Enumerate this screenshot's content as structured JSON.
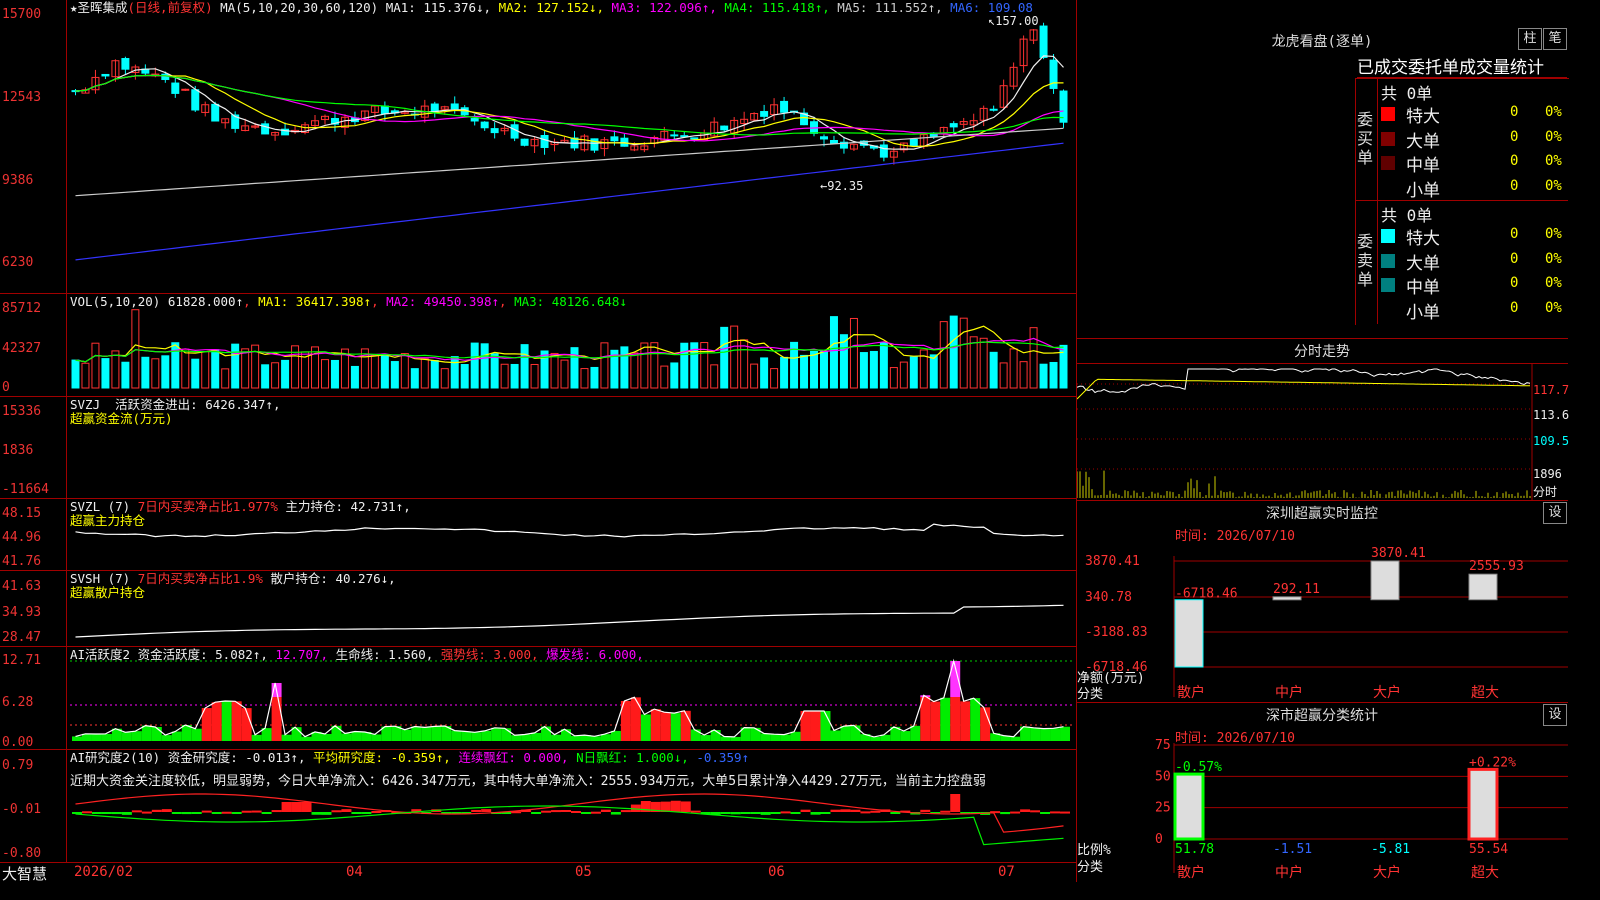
{
  "stock": {
    "name": "★圣晖集成",
    "mode": "(日线,前复权)"
  },
  "main": {
    "ma_label": "MA(5,10,20,30,60,120)",
    "ma": [
      {
        "t": "MA1: 115.376↓",
        "c": "#eeeeee"
      },
      {
        "t": "MA2: 127.152↓",
        "c": "#ffff00"
      },
      {
        "t": "MA3: 122.096↑",
        "c": "#ff00ff"
      },
      {
        "t": "MA4: 115.418↑",
        "c": "#00ff00"
      },
      {
        "t": "MA5: 111.552↑",
        "c": "#cccccc"
      },
      {
        "t": "MA6: 109.08",
        "c": "#3366ff"
      }
    ],
    "yticks": [
      "15700",
      "12543",
      "9386",
      "6230"
    ],
    "high": "157.00",
    "low": "92.35"
  },
  "vol": {
    "label": "VOL(5,10,20)",
    "v": "61828.000↑",
    "ma1": "MA1: 36417.398↑",
    "ma2": "MA2: 49450.398↑",
    "ma3": "MA3: 48126.648↓",
    "yticks": [
      "85712",
      "42327",
      "0"
    ]
  },
  "svzj": {
    "l1a": "SVZJ",
    "l1b": "活跃资金进出: 6426.347↑,",
    "l2": "超赢资金流(万元)",
    "yticks": [
      "15336",
      "1836",
      "-11664"
    ]
  },
  "svzl": {
    "l1a": "SVZL (7)",
    "l1b": "7日内买卖净占比1.977%",
    "l1c": "主力持仓: 42.731↑,",
    "l2": "超赢主力持仓",
    "yticks": [
      "48.15",
      "44.96",
      "41.76"
    ]
  },
  "svsh": {
    "l1a": "SVSH (7)",
    "l1b": "7日内买卖净占比1.9%",
    "l1c": "散户持仓: 40.276↓,",
    "l2": "超赢散户持仓",
    "yticks": [
      "41.63",
      "34.93",
      "28.47"
    ]
  },
  "ai1": {
    "a": "AI活跃度2",
    "b": "资金活跃度: 5.082↑,",
    "c": "12.707,",
    "d": "生命线: 1.560,",
    "e": "强势线: 3.000,",
    "f": "爆发线: 6.000,",
    "yticks": [
      "12.71",
      "6.28",
      "0.00"
    ]
  },
  "ai2": {
    "a": "AI研究度2(10)",
    "b": "资金研究度: -0.013↑,",
    "c": "平均研究度: -0.359↑,",
    "d": "连续飘红: 0.000,",
    "e": "N日飘红: 1.000↓,",
    "f": "-0.359↑",
    "desc": "近期大资金关注度较低，明显弱势，今日大单净流入：6426.347万元，其中特大单净流入：2555.934万元，大单5日累计净入4429.27万元，当前主力控盘弱",
    "yticks": [
      "0.79",
      "-0.01",
      "-0.80"
    ]
  },
  "xaxis": {
    "labels": [
      "2026/02",
      "04",
      "05",
      "06",
      "07"
    ],
    "brand": "大智慧"
  },
  "lhb": {
    "title": "龙虎看盘(逐单)",
    "btn1": "柱",
    "btn2": "笔",
    "tabs": "已成交委托单成交量统计",
    "buy": {
      "vlabel": "委买单",
      "total": "共 0单",
      "rows": [
        {
          "n": "特大",
          "v": "0",
          "p": "0%",
          "c": "#ff0000"
        },
        {
          "n": "大单",
          "v": "0",
          "p": "0%",
          "c": "#800000"
        },
        {
          "n": "中单",
          "v": "0",
          "p": "0%",
          "c": "#600000"
        },
        {
          "n": "小单",
          "v": "0",
          "p": "0%",
          "c": "#000000"
        }
      ]
    },
    "sell": {
      "vlabel": "委卖单",
      "total": "共 0单",
      "rows": [
        {
          "n": "特大",
          "v": "0",
          "p": "0%",
          "c": "#00ffff"
        },
        {
          "n": "大单",
          "v": "0",
          "p": "0%",
          "c": "#008080"
        },
        {
          "n": "中单",
          "v": "0",
          "p": "0%",
          "c": "#008080"
        },
        {
          "n": "小单",
          "v": "0",
          "p": "0%",
          "c": "#000000"
        }
      ]
    }
  },
  "fs": {
    "title": "分时走势",
    "yticks": [
      "117.7",
      "113.6",
      "109.5",
      "1896",
      "分时"
    ]
  },
  "sz": {
    "title": "深圳超赢实时监控",
    "btn": "设",
    "date": "时间: 2026/07/10",
    "yticks": [
      "3870.41",
      "340.78",
      "-3188.83",
      "-6718.46"
    ],
    "ylabel1": "净额(万元)",
    "ylabel2": "分类",
    "bars": [
      {
        "cat": "散户",
        "v": -6718.46,
        "lab": "-6718.46"
      },
      {
        "cat": "中户",
        "v": 292.11,
        "lab": "292.11"
      },
      {
        "cat": "大户",
        "v": 3870.41,
        "lab": "3870.41"
      },
      {
        "cat": "超大",
        "v": 2555.93,
        "lab": "2555.93"
      }
    ]
  },
  "ss": {
    "title": "深市超赢分类统计",
    "btn": "设",
    "date": "时间: 2026/07/10",
    "yticks": [
      "75",
      "50",
      "25",
      "0"
    ],
    "ylabel1": "比例%",
    "ylabel2": "分类",
    "bars": [
      {
        "cat": "散户",
        "v": 51.78,
        "top": "-0.57%"
      },
      {
        "cat": "中户",
        "v": -1.51,
        "top": ""
      },
      {
        "cat": "大户",
        "v": -5.81,
        "top": ""
      },
      {
        "cat": "超大",
        "v": 55.54,
        "top": "+0.22%"
      }
    ],
    "vals": [
      "51.78",
      "-1.51",
      "-5.81",
      "55.54"
    ]
  }
}
